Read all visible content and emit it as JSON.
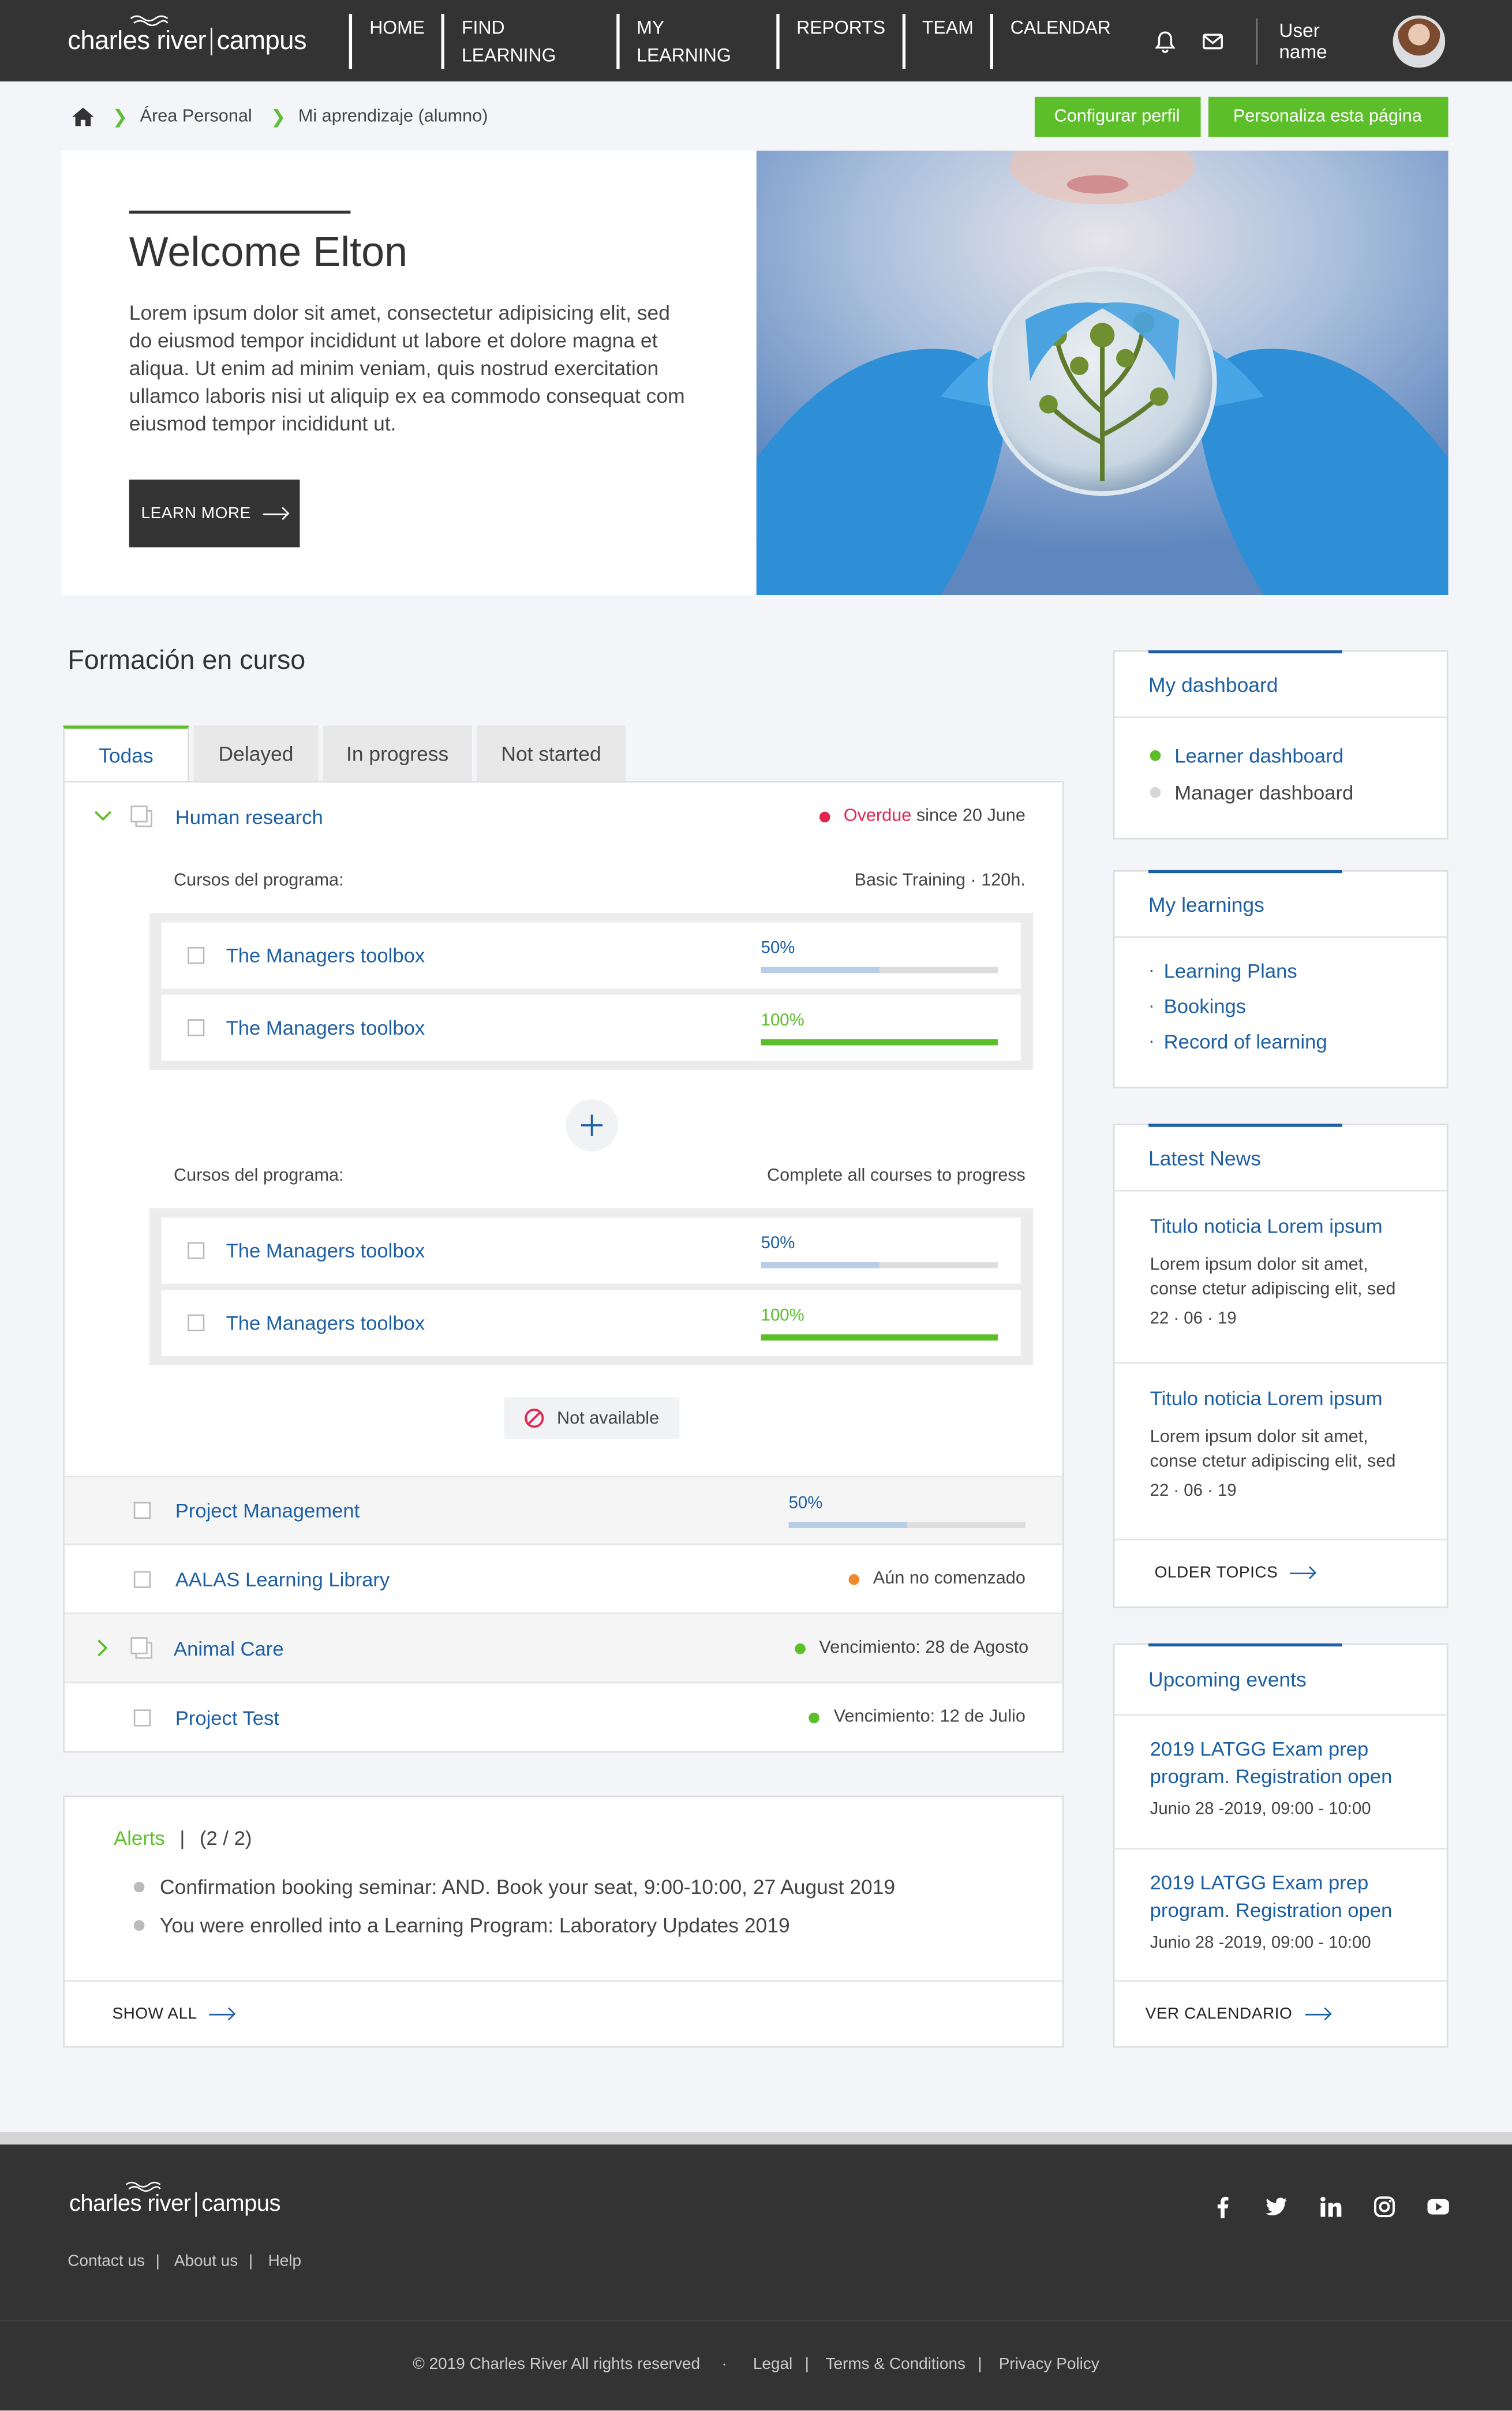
{
  "header": {
    "logo_left": "charles river",
    "logo_right": "campus",
    "nav": [
      "HOME",
      "FIND LEARNING",
      "MY LEARNING",
      "REPORTS",
      "TEAM",
      "CALENDAR"
    ],
    "username": "User name"
  },
  "breadcrumb": {
    "items": [
      "Área Personal",
      "Mi aprendizaje (alumno)"
    ],
    "btn_profile": "Configurar perfil",
    "btn_customize": "Personaliza esta página"
  },
  "hero": {
    "title": "Welcome Elton",
    "body": "Lorem ipsum dolor sit amet, consectetur adipisicing elit, sed do eiusmod tempor incididunt ut labore et dolore magna et aliqua. Ut enim ad minim veniam, quis nostrud exercitation ullamco laboris nisi ut aliquip ex ea commodo consequat com eiusmod tempor incididunt ut.",
    "cta": "LEARN MORE"
  },
  "main": {
    "title": "Formación en curso",
    "tabs": [
      "Todas",
      "Delayed",
      "In progress",
      "Not started"
    ],
    "program": {
      "name": "Human research",
      "overdue": "Overdue",
      "overdue_since": "since 20 June",
      "group1_label": "Cursos del programa:",
      "group1_meta": "Basic Training  ·  120h.",
      "group2_label": "Cursos del programa:",
      "group2_meta": "Complete all courses to progress",
      "group1_courses": [
        {
          "name": "The Managers toolbox",
          "pct_label": "50%",
          "progress": 0.5,
          "color": "#b8cde6",
          "label_color": "#1d5fa3"
        },
        {
          "name": "The Managers toolbox",
          "pct_label": "100%",
          "progress": 1.0,
          "color": "#5cbf2a",
          "label_color": "#5cbf2a"
        }
      ],
      "group2_courses": [
        {
          "name": "The Managers toolbox",
          "pct_label": "50%",
          "progress": 0.5,
          "color": "#b8cde6",
          "label_color": "#1d5fa3"
        },
        {
          "name": "The Managers toolbox",
          "pct_label": "100%",
          "progress": 1.0,
          "color": "#5cbf2a",
          "label_color": "#5cbf2a"
        }
      ],
      "not_available": "Not available"
    },
    "rows": [
      {
        "name": "Project Management",
        "pct_label": "50%",
        "progress": 0.5
      },
      {
        "name": "AALAS Learning Library",
        "status": "Aún no comenzado",
        "dot": "#f08a2c"
      },
      {
        "name": "Animal Care",
        "status": "Vencimiento: 28 de Agosto",
        "dot": "#5cbf2a"
      },
      {
        "name": "Project Test",
        "status": "Vencimiento: 12 de Julio",
        "dot": "#5cbf2a"
      }
    ]
  },
  "alerts": {
    "title": "Alerts",
    "count": "(2 / 2)",
    "items": [
      "Confirmation booking seminar: AND. Book your seat, 9:00-10:00, 27 August 2019",
      "You were enrolled into a Learning Program: Laboratory Updates 2019"
    ],
    "show_all": "SHOW ALL"
  },
  "sidebar": {
    "dashboard": {
      "title": "My dashboard",
      "items": [
        "Learner dashboard",
        "Manager dashboard"
      ]
    },
    "learnings": {
      "title": "My learnings",
      "items": [
        "Learning Plans",
        "Bookings",
        "Record of learning"
      ]
    },
    "news": {
      "title": "Latest News",
      "items": [
        {
          "title": "Titulo noticia Lorem ipsum",
          "body": "Lorem ipsum dolor sit amet, conse ctetur adipiscing elit, sed",
          "date": "22 · 06 · 19"
        },
        {
          "title": "Titulo noticia Lorem ipsum",
          "body": "Lorem ipsum dolor sit amet, conse ctetur adipiscing elit, sed",
          "date": "22 · 06 · 19"
        }
      ],
      "older": "OLDER TOPICS"
    },
    "events": {
      "title": "Upcoming events",
      "items": [
        {
          "title": "2019 LATGG Exam prep program. Registration open",
          "date": "Junio 28 -2019, 09:00 - 10:00"
        },
        {
          "title": "2019 LATGG Exam prep program. Registration open",
          "date": "Junio 28 -2019, 09:00 - 10:00"
        }
      ],
      "calendar": "VER CALENDARIO"
    }
  },
  "footer": {
    "logo_left": "charles river",
    "logo_right": "campus",
    "links": [
      "Contact us",
      "About us",
      "Help"
    ],
    "copyright": "© 2019 Charles River All rights reserved",
    "legal": [
      "Legal",
      "Terms & Conditions",
      "Privacy Policy"
    ],
    "social": [
      "facebook-icon",
      "twitter-icon",
      "linkedin-icon",
      "instagram-icon",
      "youtube-icon"
    ]
  }
}
